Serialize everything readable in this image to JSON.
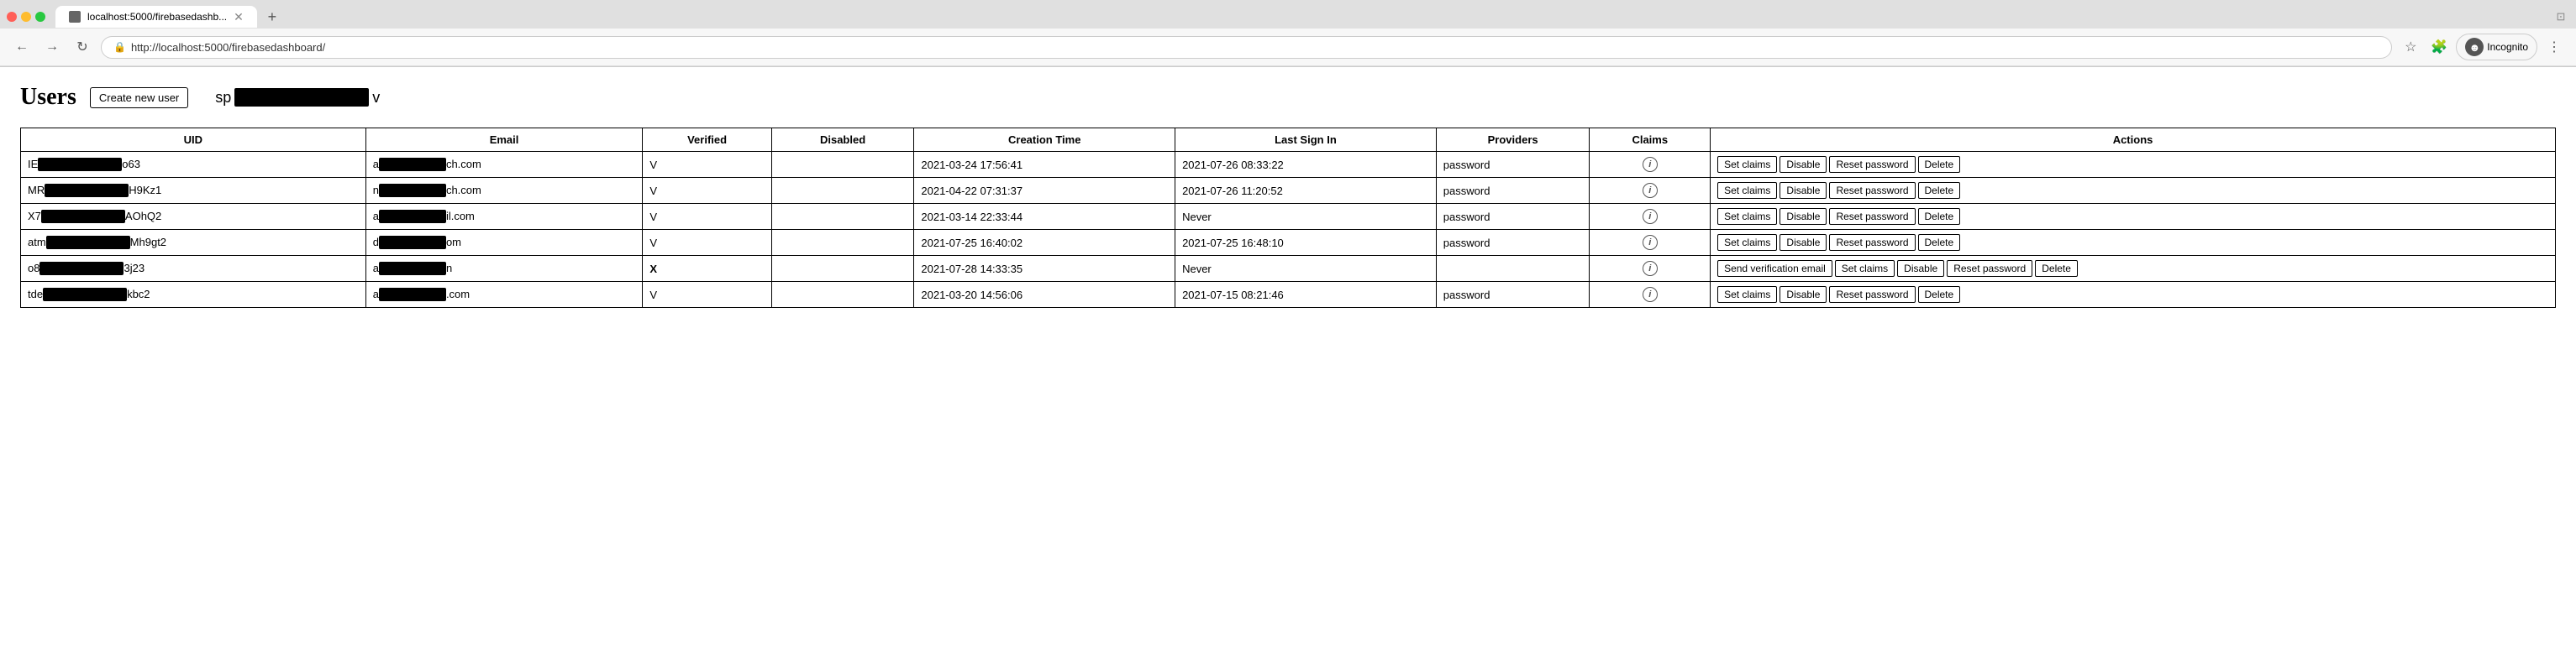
{
  "browser": {
    "tab_title": "localhost:5000/firebasedashb...",
    "url": "http://localhost:5000/firebasedashboard/",
    "incognito_label": "Incognito"
  },
  "page": {
    "title": "Users",
    "create_button": "Create new user",
    "search_prefix": "sp",
    "search_suffix": "v"
  },
  "table": {
    "headers": [
      "UID",
      "Email",
      "Verified",
      "Disabled",
      "Creation Time",
      "Last Sign In",
      "Providers",
      "Claims",
      "Actions"
    ],
    "rows": [
      {
        "uid_prefix": "IE",
        "uid_suffix": "o63",
        "email_prefix": "a",
        "email_suffix": "ch.com",
        "verified": "V",
        "disabled": "",
        "creation": "2021-03-24 17:56:41",
        "last_sign_in": "2021-07-26 08:33:22",
        "providers": "password",
        "has_claims": true,
        "unverified": false,
        "actions": [
          "Set claims",
          "Disable",
          "Reset password",
          "Delete"
        ]
      },
      {
        "uid_prefix": "MR",
        "uid_suffix": "H9Kz1",
        "email_prefix": "n",
        "email_suffix": "ch.com",
        "verified": "V",
        "disabled": "",
        "creation": "2021-04-22 07:31:37",
        "last_sign_in": "2021-07-26 11:20:52",
        "providers": "password",
        "has_claims": true,
        "unverified": false,
        "actions": [
          "Set claims",
          "Disable",
          "Reset password",
          "Delete"
        ]
      },
      {
        "uid_prefix": "X7",
        "uid_suffix": "AOhQ2",
        "email_prefix": "a",
        "email_suffix": "il.com",
        "verified": "V",
        "disabled": "",
        "creation": "2021-03-14 22:33:44",
        "last_sign_in": "Never",
        "providers": "password",
        "has_claims": true,
        "unverified": false,
        "actions": [
          "Set claims",
          "Disable",
          "Reset password",
          "Delete"
        ]
      },
      {
        "uid_prefix": "atm",
        "uid_suffix": "Mh9gt2",
        "email_prefix": "d",
        "email_suffix": "om",
        "verified": "V",
        "disabled": "",
        "creation": "2021-07-25 16:40:02",
        "last_sign_in": "2021-07-25 16:48:10",
        "providers": "password",
        "has_claims": true,
        "unverified": false,
        "actions": [
          "Set claims",
          "Disable",
          "Reset password",
          "Delete"
        ]
      },
      {
        "uid_prefix": "o8",
        "uid_suffix": "3j23",
        "email_prefix": "a",
        "email_suffix": "n",
        "verified": "X",
        "disabled": "",
        "creation": "2021-07-28 14:33:35",
        "last_sign_in": "Never",
        "providers": "",
        "has_claims": true,
        "unverified": true,
        "actions": [
          "Send verification email",
          "Set claims",
          "Disable",
          "Reset password",
          "Delete"
        ]
      },
      {
        "uid_prefix": "tde",
        "uid_suffix": "kbc2",
        "email_prefix": "a",
        "email_suffix": ".com",
        "verified": "V",
        "disabled": "",
        "creation": "2021-03-20 14:56:06",
        "last_sign_in": "2021-07-15 08:21:46",
        "providers": "password",
        "has_claims": true,
        "unverified": false,
        "actions": [
          "Set claims",
          "Disable",
          "Reset password",
          "Delete"
        ]
      }
    ]
  }
}
